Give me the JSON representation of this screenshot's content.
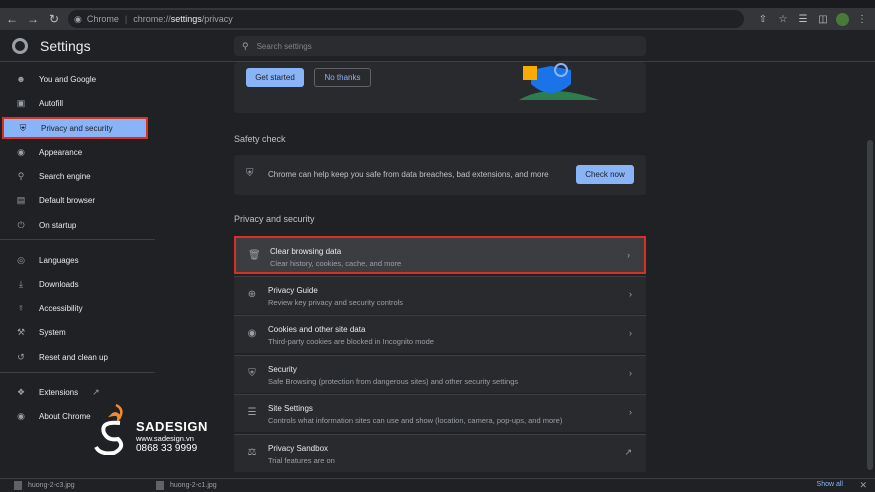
{
  "browser": {
    "omnibox": {
      "brand": "Chrome",
      "host": "chrome://",
      "path": "settings",
      "subpath": "/privacy"
    }
  },
  "header": {
    "title": "Settings",
    "search_placeholder": "Search settings"
  },
  "sidebar": {
    "items": [
      {
        "label": "You and Google",
        "icon": "person-icon"
      },
      {
        "label": "Autofill",
        "icon": "clipboard-icon"
      },
      {
        "label": "Privacy and security",
        "icon": "shield-icon",
        "active": true
      },
      {
        "label": "Appearance",
        "icon": "palette-icon"
      },
      {
        "label": "Search engine",
        "icon": "search-icon"
      },
      {
        "label": "Default browser",
        "icon": "browser-icon"
      },
      {
        "label": "On startup",
        "icon": "power-icon"
      },
      {
        "label": "Languages",
        "icon": "globe-icon"
      },
      {
        "label": "Downloads",
        "icon": "download-icon"
      },
      {
        "label": "Accessibility",
        "icon": "accessibility-icon"
      },
      {
        "label": "System",
        "icon": "wrench-icon"
      },
      {
        "label": "Reset and clean up",
        "icon": "reset-icon"
      },
      {
        "label": "Extensions",
        "icon": "puzzle-icon"
      },
      {
        "label": "About Chrome",
        "icon": "chrome-icon"
      }
    ]
  },
  "promo": {
    "get_started": "Get started",
    "no_thanks": "No thanks"
  },
  "safety_check": {
    "title": "Safety check",
    "text": "Chrome can help keep you safe from data breaches, bad extensions, and more",
    "button": "Check now"
  },
  "privacy": {
    "title": "Privacy and security",
    "rows": [
      {
        "title": "Clear browsing data",
        "subtitle": "Clear history, cookies, cache, and more",
        "icon": "trash-icon"
      },
      {
        "title": "Privacy Guide",
        "subtitle": "Review key privacy and security controls",
        "icon": "compass-icon"
      },
      {
        "title": "Cookies and other site data",
        "subtitle": "Third-party cookies are blocked in Incognito mode",
        "icon": "cookie-icon"
      },
      {
        "title": "Security",
        "subtitle": "Safe Browsing (protection from dangerous sites) and other security settings",
        "icon": "shield-icon"
      },
      {
        "title": "Site Settings",
        "subtitle": "Controls what information sites can use and show (location, camera, pop-ups, and more)",
        "icon": "sliders-icon"
      },
      {
        "title": "Privacy Sandbox",
        "subtitle": "Trial features are on",
        "icon": "flask-icon"
      }
    ]
  },
  "downloads_bar": {
    "file1": "huong-2-c3.jpg",
    "file2": "huong-2-c1.jpg",
    "show_all": "Show all"
  },
  "watermark": {
    "brand": "SADESIGN",
    "url": "www.sadesign.vn",
    "phone": "0868 33 9999"
  },
  "colors": {
    "accent": "#8ab4f8",
    "highlight": "#d93025",
    "background": "#202124",
    "card": "#292a2d"
  }
}
